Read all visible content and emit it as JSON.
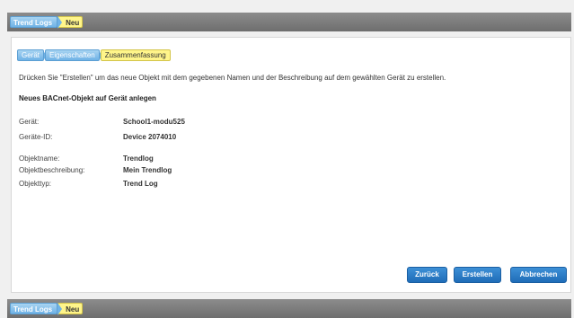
{
  "breadcrumb": {
    "parent": "Trend Logs",
    "current": "Neu"
  },
  "wizard": {
    "steps": [
      "Gerät",
      "Eigenschaften",
      "Zusammenfassung"
    ],
    "active_step": "Zusammenfassung"
  },
  "summary": {
    "instruction": "Drücken Sie \"Erstellen\" um das neue Objekt mit dem gegebenen Namen und der Beschreibung auf dem gewählten Gerät zu erstellen.",
    "section_title": "Neues BACnet-Objekt auf Gerät anlegen",
    "device_label": "Gerät:",
    "device_value": "School1-modu525",
    "device_id_label": "Geräte-ID:",
    "device_id_value": "Device 2074010",
    "object_name_label": "Objektname:",
    "object_name_value": "Trendlog",
    "object_desc_label": "Objektbeschreibung:",
    "object_desc_value": "Mein Trendlog",
    "object_type_label": "Objekttyp:",
    "object_type_value": "Trend Log"
  },
  "buttons": {
    "back": "Zurück",
    "create": "Erstellen",
    "cancel": "Abbrechen"
  },
  "colors": {
    "accent": "#2a7cc7",
    "active_step": "#fff58a",
    "step": "#6fb2e6"
  }
}
